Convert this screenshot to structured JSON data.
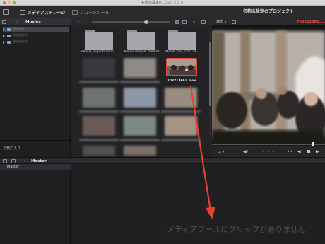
{
  "window": {
    "title": "名称未設定のプロジェクト"
  },
  "toolbar": {
    "media_storage_label": "メディアストレージ",
    "clone_tool_label": "クローンツール",
    "project_title": "名称未設定のプロジェクト"
  },
  "subbar": {
    "folder_label": "Movies",
    "viewer_mode": "適応",
    "timecode": "708213662.r…"
  },
  "sidebar": {
    "items": [
      {
        "label": "Movies"
      },
      {
        "label": "Volume 1"
      },
      {
        "label": "Volume 2"
      }
    ],
    "favorites_label": "お気に入り"
  },
  "media": {
    "folders": [
      {
        "caption": "iMovie Projects.local..."
      },
      {
        "caption": "iMovie Theater.theater"
      },
      {
        "caption": "iMovie ライブラリ.im..."
      }
    ],
    "selected_clip_caption": "708213662.mov"
  },
  "timeline": {
    "tab_label": "Master",
    "master_item": "Master",
    "empty_message": "メディアプールにクリップがありません"
  },
  "colors": {
    "accent": "#e84a3f",
    "selection": "#e9493b",
    "annotation_arrow": "#e8412d"
  }
}
